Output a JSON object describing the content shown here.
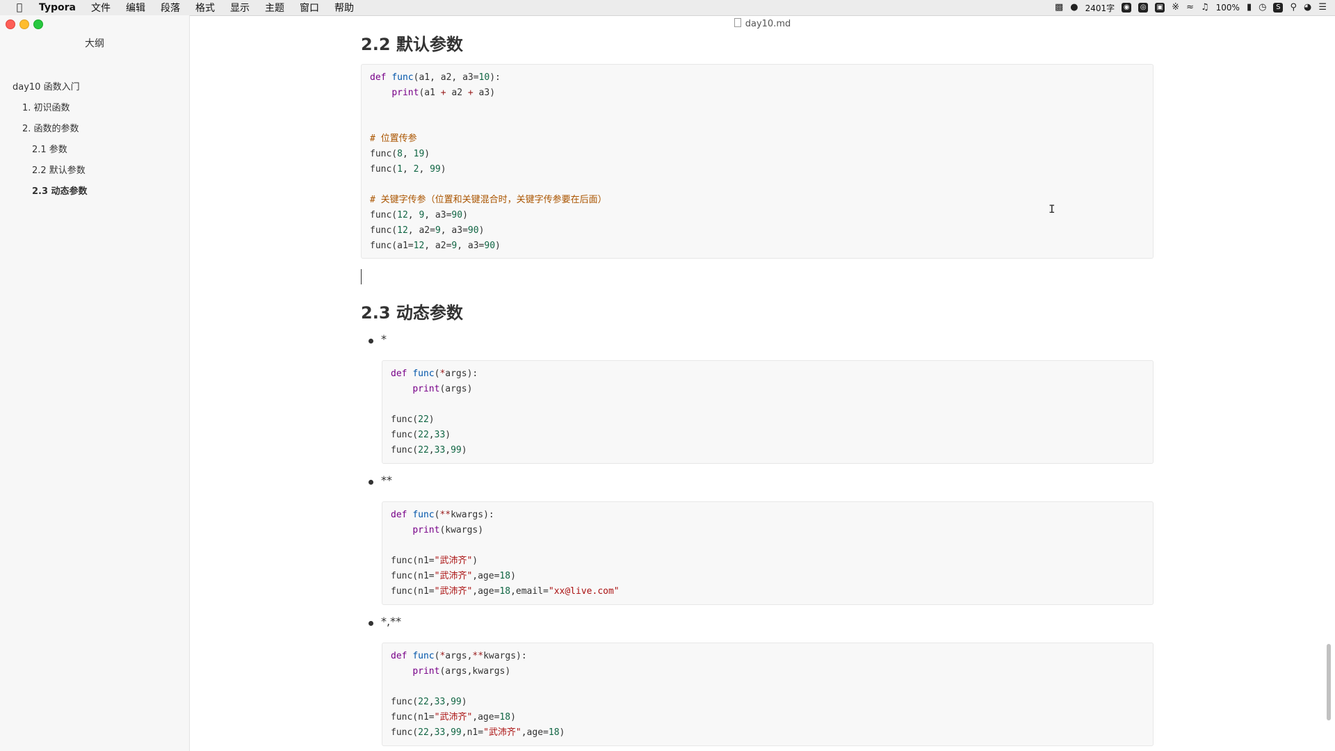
{
  "menubar": {
    "app": "Typora",
    "menus": [
      "文件",
      "编辑",
      "段落",
      "格式",
      "显示",
      "主题",
      "窗口",
      "帮助"
    ],
    "word_count": "2401字",
    "battery": "100%",
    "icons": [
      "camera-icon",
      "wechat-icon",
      "input-icon",
      "mic-icon",
      "ime-icon",
      "bluetooth-icon",
      "wifi-icon",
      "volume-icon",
      "battery-icon",
      "clock-icon",
      "app-icon",
      "search-icon",
      "siri-icon",
      "list-icon"
    ]
  },
  "window": {
    "filename": "day10.md"
  },
  "sidebar": {
    "title": "大纲",
    "items": [
      {
        "label": "day10 函数入门",
        "level": 0
      },
      {
        "label": "1. 初识函数",
        "level": 1
      },
      {
        "label": "2. 函数的参数",
        "level": 1
      },
      {
        "label": "2.1 参数",
        "level": 2
      },
      {
        "label": "2.2 默认参数",
        "level": 2
      },
      {
        "label": "2.3 动态参数",
        "level": 2,
        "active": true
      }
    ]
  },
  "doc": {
    "h_default": "2.2 默认参数",
    "h_dynamic": "2.3 动态参数",
    "bullet1": "*",
    "bullet2": "**",
    "bullet3": "*,**"
  }
}
